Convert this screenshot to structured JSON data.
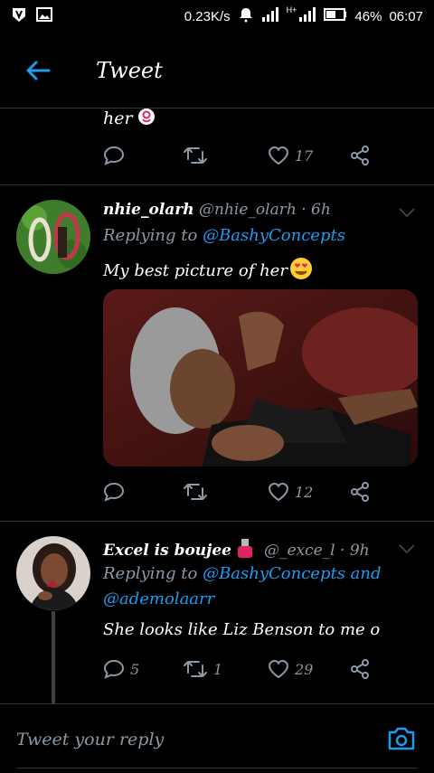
{
  "status_bar": {
    "speed": "0.23K/s",
    "network_label": "H+",
    "battery": "46%",
    "time": "06:07"
  },
  "app_bar": {
    "title": "Tweet"
  },
  "prev_tweet": {
    "text": "her",
    "emoji_icon": "ok-hand-icon",
    "likes": "17"
  },
  "tweets": [
    {
      "name": "nhie_olarh",
      "handle": "@nhie_olarh · 6h",
      "replying_label": "Replying to",
      "replying_to": "@BashyConcepts",
      "replying_to_2": "",
      "text": "My best picture of her",
      "emoji_icon": "heart-eyes-face-icon",
      "replies": "",
      "retweets": "",
      "likes": "12"
    },
    {
      "name": "Excel is boujee",
      "handle": "@_exce_l · 9h",
      "replying_label": "Replying to",
      "replying_to": "@BashyConcepts and",
      "replying_to_2": "@ademolaarr",
      "text": "She looks like Liz Benson to me o",
      "emoji_icon": "nail-polish-icon",
      "replies": "5",
      "retweets": "1",
      "likes": "29"
    }
  ],
  "composer": {
    "placeholder": "Tweet your reply"
  },
  "colors": {
    "accent": "#1d9bf0",
    "muted": "#8b98a5",
    "divider": "#2f3336"
  }
}
